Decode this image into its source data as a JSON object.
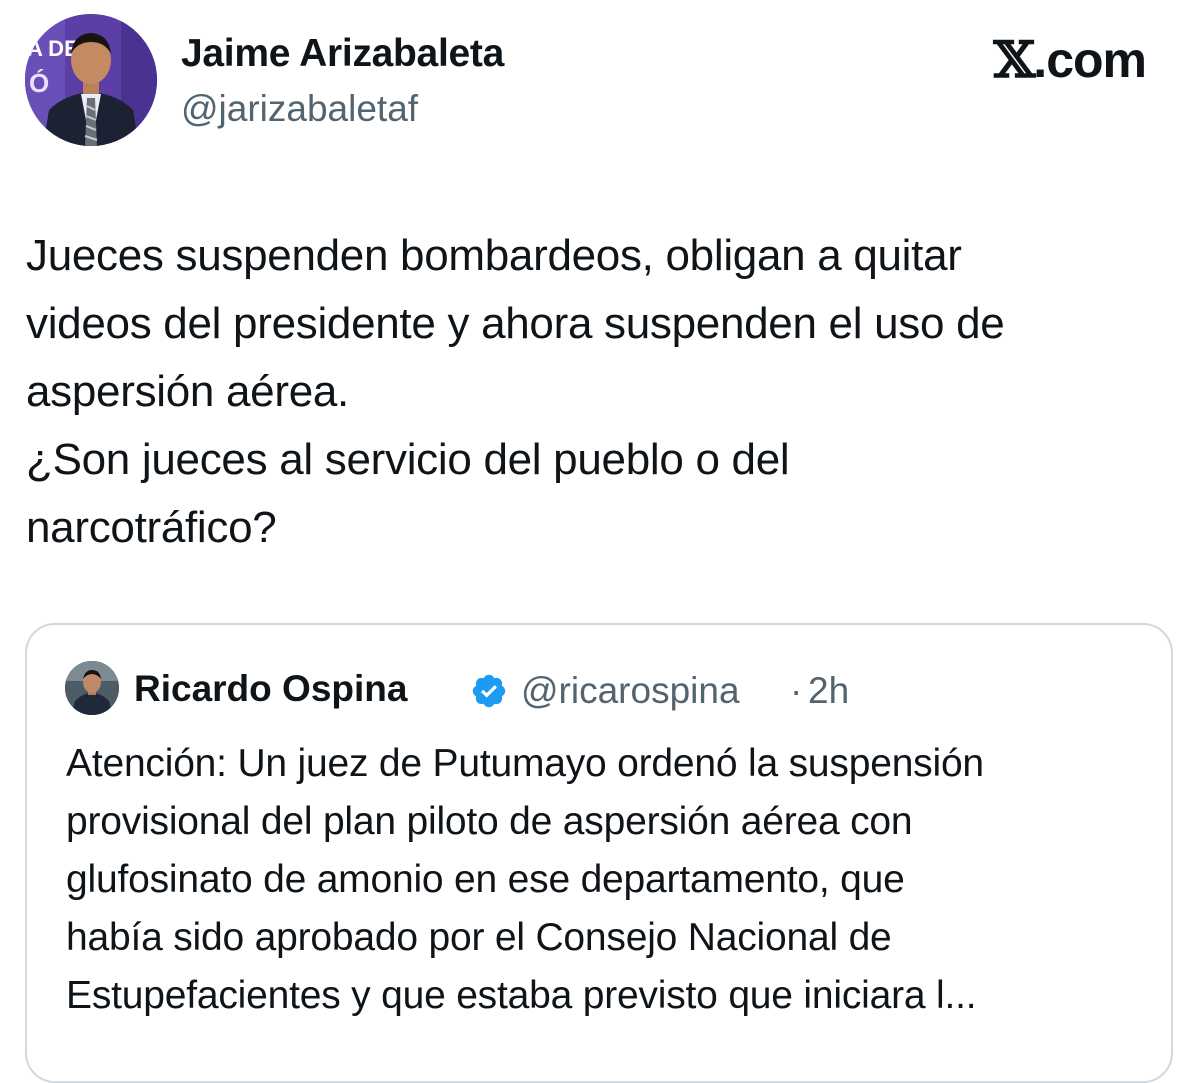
{
  "brand": {
    "logo_letter": "𝕏",
    "logo_suffix": ".com",
    "icon": "x-logo-icon"
  },
  "author": {
    "name": "Jaime Arizabaleta",
    "handle": "@jarizabaletaf",
    "avatar_icon": "profile-photo-avatar",
    "avatar_bg_text": "A DE"
  },
  "tweet": {
    "lines": [
      "Jueces suspenden bombardeos, obligan a quitar",
      "videos del presidente y ahora suspenden el uso de",
      "aspersión aérea.",
      "¿Son jueces al servicio del pueblo o del",
      "narcotráfico?"
    ]
  },
  "quote": {
    "name": "Ricardo Ospina",
    "verified_icon": "verified-badge-icon",
    "handle": "@ricarospina",
    "separator": "·",
    "time": "2h",
    "lines": [
      "Atención: Un juez de Putumayo ordenó la suspensión",
      "provisional del plan piloto de aspersión aérea con",
      "glufosinato de amonio en ese departamento, que",
      "había sido aprobado por el Consejo Nacional de",
      "Estupefacientes y que estaba previsto que iniciara l..."
    ]
  },
  "colors": {
    "text": "#0f1419",
    "secondary": "#536471",
    "border": "#cfd9de",
    "verified": "#1d9bf0",
    "avatar_bg": "#5b3fa6"
  }
}
